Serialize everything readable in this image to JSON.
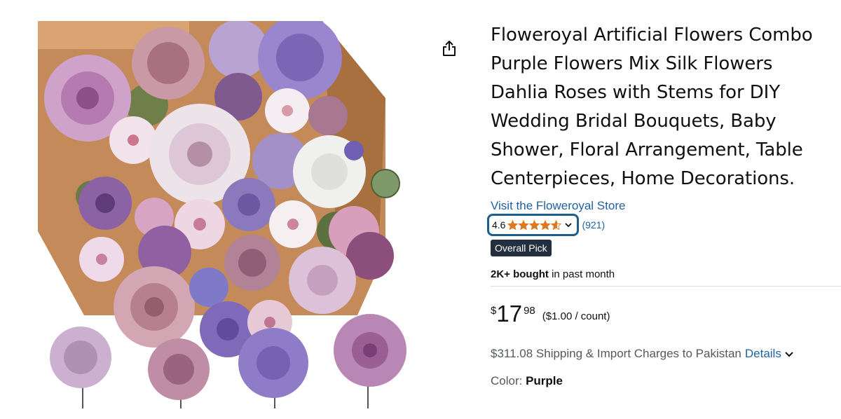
{
  "product": {
    "title": "Floweroyal Artificial Flowers Combo Purple Flowers Mix Silk Flowers Dahlia Roses with Stems for DIY Wedding Bridal Bouquets, Baby Shower, Floral Arrangement, Table Centerpieces, Home Decorations.",
    "store_link": "Visit the Floweroyal Store",
    "image_alt": "Floweroyal Artificial Flowers Combo Purple"
  },
  "rating": {
    "value": "4.6",
    "stars": 4.6,
    "review_count": "(921)",
    "icons": [
      "star-icon",
      "chevron-down-icon"
    ]
  },
  "badge": {
    "label": "Overall Pick"
  },
  "bought": {
    "strong": "2K+ bought",
    "rest": " in past month"
  },
  "price": {
    "symbol": "$",
    "whole": "17",
    "fraction": "98",
    "unit_price": "($1.00 / count)"
  },
  "shipping": {
    "text": "$311.08 Shipping & Import Charges to Pakistan",
    "details_label": "Details"
  },
  "color": {
    "label": "Color: ",
    "value": "Purple"
  },
  "colors": {
    "link": "#2162a1",
    "badge_bg": "#232f3e",
    "star": "#de7921",
    "focus_ring": "#1f5e8c"
  }
}
